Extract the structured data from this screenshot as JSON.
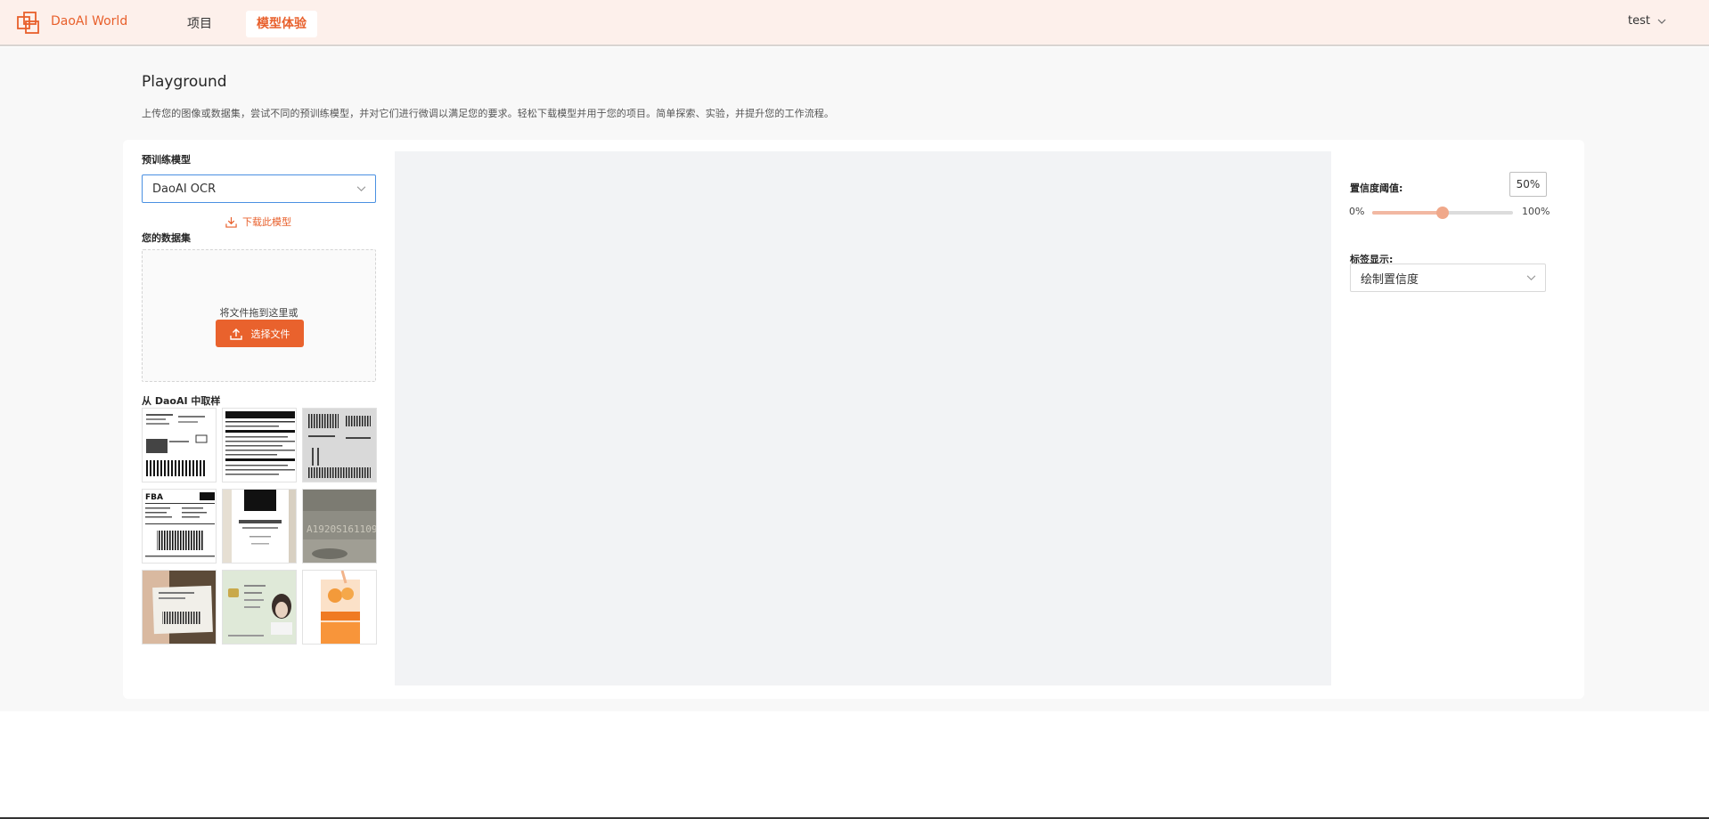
{
  "header": {
    "brand": "DaoAI World",
    "nav": [
      {
        "label": "项目",
        "active": false
      },
      {
        "label": "模型体验",
        "active": true
      }
    ],
    "user": "test"
  },
  "page": {
    "title": "Playground",
    "description": "上传您的图像或数据集，尝试不同的预训练模型，并对它们进行微调以满足您的要求。轻松下载模型并用于您的项目。简单探索、实验，并提升您的工作流程。"
  },
  "left": {
    "model_label": "预训练模型",
    "model_value": "DaoAI OCR",
    "download_label": "下载此模型",
    "dataset_label": "您的数据集",
    "drop_text": "将文件拖到这里或",
    "upload_label": "选择文件",
    "samples_label": "从 DaoAI 中取样",
    "samples": [
      "shipping-label-sample",
      "nutrition-facts-sample",
      "barcode-sheet-sample",
      "fba-label-sample",
      "wine-bottle-sample",
      "engraved-metal-sample",
      "package-label-sample",
      "id-card-sample",
      "juice-box-sample"
    ]
  },
  "right": {
    "confidence_label": "置信度阈值:",
    "confidence_value": "50%",
    "confidence_fraction": 0.5,
    "slider_min": "0%",
    "slider_max": "100%",
    "tag_label": "标签显示:",
    "tag_value": "绘制置信度"
  },
  "colors": {
    "accent": "#e8602c",
    "header_bg": "#fdf0eb",
    "canvas_bg": "#f2f3f5"
  }
}
